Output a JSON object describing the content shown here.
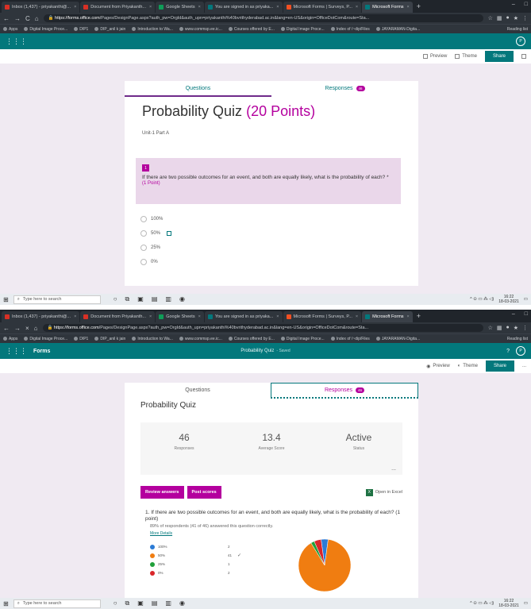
{
  "browser": {
    "tabs": [
      "Inbox (1,437) - priyakanthi@...",
      "Document from Priyakanth...",
      "Google Sheets",
      "You are signed in as priyaka...",
      "Microsoft Forms | Surveys, P...",
      "Microsoft Forms"
    ],
    "url_prefix": "https://forms.office.com",
    "url_rest": "/Pages/DesignPage.aspx?auth_pw=OrgId&auth_upn=priyakanthi%40bvrithyderabad.ac.in&lang=en-US&origin=OfficeDotCom&route=Sta...",
    "bookmarks": [
      "Apps",
      "Digital Image Proce...",
      "DIP1",
      "DIP_anil k jain",
      "Introduction to Wa...",
      "www.commsp.ee.ic...",
      "Courses offered by E...",
      "Digital Image Proce...",
      "Index of /~dip/Files",
      "JAYARAMAN-Digita..."
    ],
    "reading_list": "Reading list"
  },
  "app": {
    "name": "Forms",
    "doc_title": "Probability Quiz",
    "saved": "- Saved",
    "help": "?",
    "avatar": "P",
    "preview": "Preview",
    "theme": "Theme",
    "share": "Share",
    "ellipsis": "..."
  },
  "tabs": {
    "questions": "Questions",
    "responses": "Responses",
    "count": "46"
  },
  "design": {
    "title": "Probability Quiz",
    "points": "(20 Points)",
    "subtitle": "Unit-1 Part A",
    "qnum": "1",
    "question": "If there are two possible outcomes for an event, and both are equally likely, what is the probability of each? *",
    "point": "(1 Point)",
    "options": [
      "100%",
      "50%",
      "25%",
      "0%"
    ]
  },
  "responses": {
    "title": "Probability Quiz",
    "stats": [
      {
        "value": "46",
        "label": "Responses"
      },
      {
        "value": "13.4",
        "label": "Average Score"
      },
      {
        "value": "Active",
        "label": "Status"
      }
    ],
    "review": "Review answers",
    "post": "Post scores",
    "excel": "Open in Excel",
    "question": "1. If there are two possible outcomes for an event, and both are equally likely, what is the probability of each? (1 point)",
    "correct": "89% of respondents (41 of 46) answered this question correctly.",
    "more": "More Details",
    "legend": [
      {
        "label": "100%",
        "count": "2",
        "color": "#2b7bd6"
      },
      {
        "label": "50%",
        "count": "41",
        "color": "#f07d11",
        "correct": true
      },
      {
        "label": "25%",
        "count": "1",
        "color": "#20a03a"
      },
      {
        "label": "0%",
        "count": "2",
        "color": "#d9262a"
      }
    ]
  },
  "taskbar": {
    "search": "Type here to search",
    "time": "16:22",
    "date": "18-03-2021"
  }
}
